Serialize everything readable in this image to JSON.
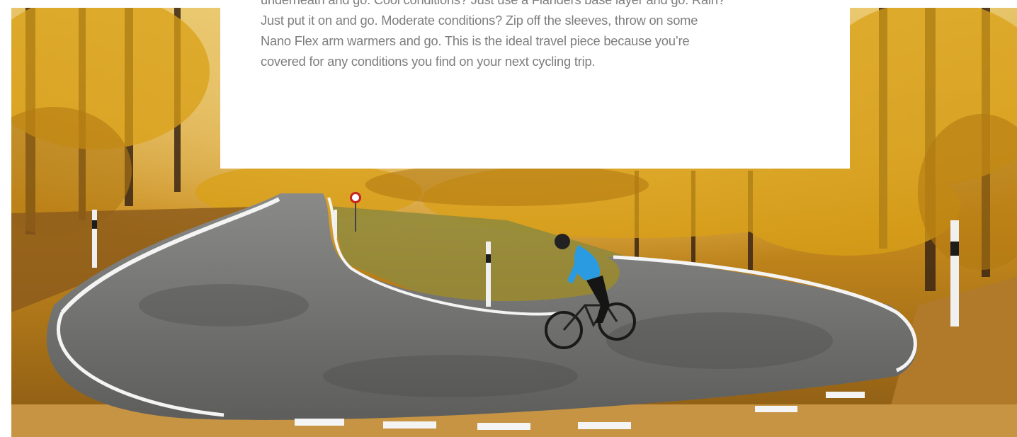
{
  "hero_image": {
    "icon": "cyclist-switchback-photo"
  },
  "description": {
    "lines": [
      "underneath and go. Cool conditions? Just use a Flanders base layer and go. Rain?",
      "Just put it on and go. Moderate conditions? Zip off the sleeves, throw on some",
      "Nano Flex arm warmers and go. This is the ideal travel piece because you’re",
      "covered for any conditions you find on your next cycling trip."
    ]
  },
  "colors": {
    "foliage": "#d9a017",
    "road": "#6f6f6f",
    "text": "#7d7d7d",
    "jersey": "#2a9be0"
  }
}
